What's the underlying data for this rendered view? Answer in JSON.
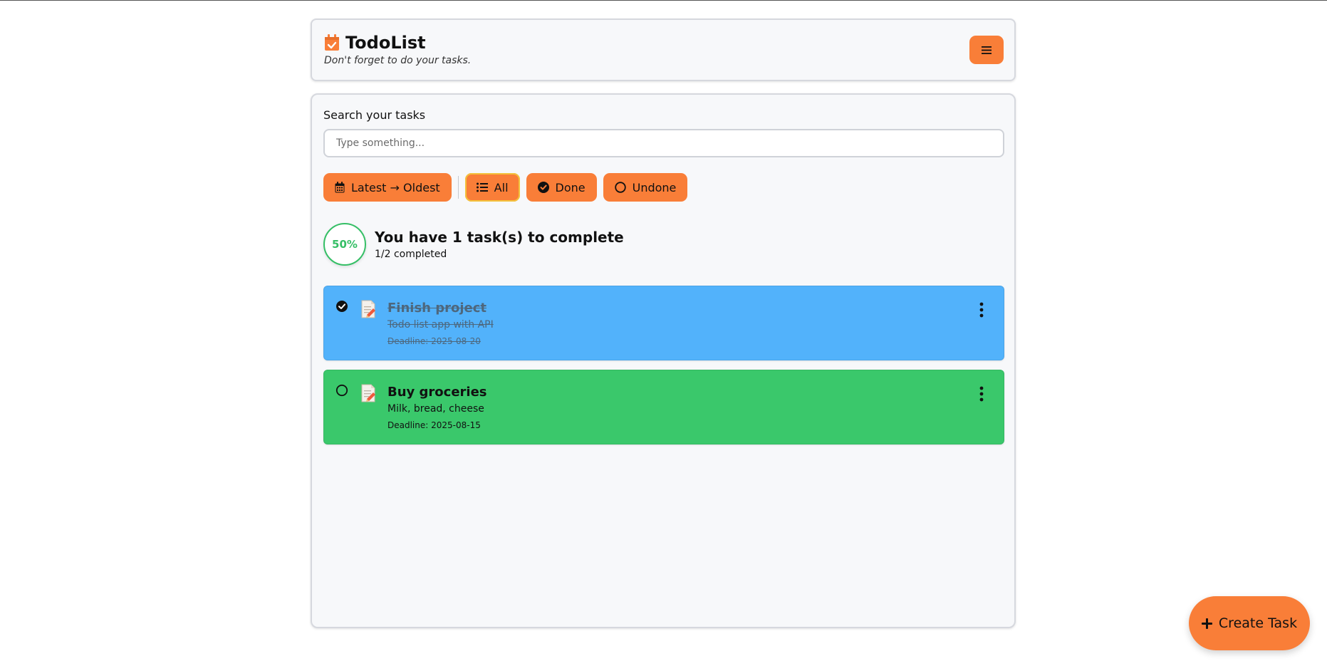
{
  "header": {
    "title": "TodoList",
    "subtitle": "Don't forget to do your tasks.",
    "icon": "calendar-check-icon",
    "menu_icon": "hamburger-icon"
  },
  "search": {
    "label": "Search your tasks",
    "placeholder": "Type something...",
    "value": ""
  },
  "filters": {
    "sort_label": "Latest → Oldest",
    "all_label": "All",
    "done_label": "Done",
    "undone_label": "Undone",
    "active": "All"
  },
  "progress": {
    "percent_label": "50%",
    "percent": 50,
    "title": "You have 1 task(s) to complete",
    "subtitle": "1/2 completed"
  },
  "tasks": [
    {
      "title": "Finish project",
      "description": "Todo list app with API",
      "deadline": "Deadline: 2025-08-20",
      "done": true,
      "color": "#52b2fb"
    },
    {
      "title": "Buy groceries",
      "description": "Milk, bread, cheese",
      "deadline": "Deadline: 2025-08-15",
      "done": false,
      "color": "#3ac86b"
    }
  ],
  "fab": {
    "label": "Create Task"
  },
  "colors": {
    "accent": "#f97e38",
    "progress": "#35bf66"
  }
}
